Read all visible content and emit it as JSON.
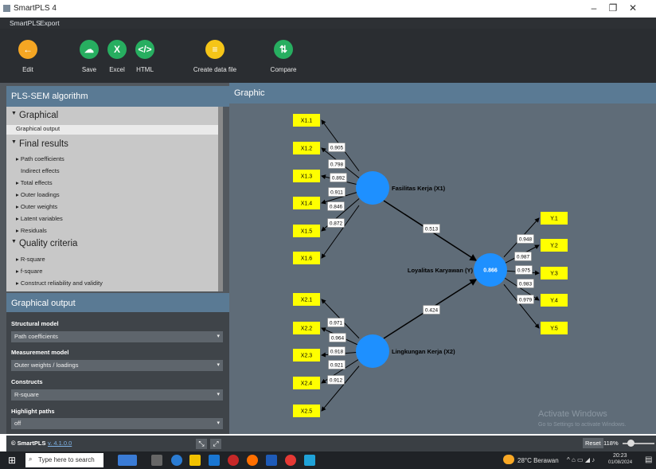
{
  "window": {
    "title": "SmartPLS 4"
  },
  "menu": [
    "SmartPLS",
    "Export"
  ],
  "toolbar": {
    "edit": "Edit",
    "save": "Save",
    "excel": "Excel",
    "html": "HTML",
    "create_data_file": "Create data file",
    "compare": "Compare",
    "colors": {
      "edit": "#f5a623",
      "save": "#27ae60",
      "excel": "#27ae60",
      "html": "#27ae60",
      "create": "#f5c518",
      "compare": "#27ae60"
    }
  },
  "left_panel": {
    "title": "PLS-SEM algorithm",
    "graphical": "Graphical",
    "graphical_output": "Graphical output",
    "final_results": "Final results",
    "final_items": [
      "Path coefficients",
      "Indirect effects",
      "Total effects",
      "Outer loadings",
      "Outer weights",
      "Latent variables",
      "Residuals"
    ],
    "quality_criteria": "Quality criteria",
    "quality_items": [
      "R-square",
      "f-square",
      "Construct reliability and validity"
    ]
  },
  "graphical_output_panel": {
    "title": "Graphical output",
    "structural_model": "Structural model",
    "structural_value": "Path coefficients",
    "measurement_model": "Measurement model",
    "measurement_value": "Outer weights / loadings",
    "constructs": "Constructs",
    "constructs_value": "R-square",
    "highlight_paths": "Highlight paths",
    "highlight_value": "off"
  },
  "footer": {
    "brand": "© SmartPLS",
    "version": "v. 4.1.0.0"
  },
  "main": {
    "title": "Graphic"
  },
  "model": {
    "x1_indicators": [
      "X1.1",
      "X1.2",
      "X1.3",
      "X1.4",
      "X1.5",
      "X1.6"
    ],
    "x1_loadings": [
      "0.905",
      "0.798",
      "0.892",
      "0.911",
      "0.846",
      "0.872"
    ],
    "x2_indicators": [
      "X2.1",
      "X2.2",
      "X2.3",
      "X2.4",
      "X2.5"
    ],
    "x2_loadings": [
      "0.971",
      "0.964",
      "0.918",
      "0.921",
      "0.912"
    ],
    "y_indicators": [
      "Y.1",
      "Y.2",
      "Y.3",
      "Y.4",
      "Y.5"
    ],
    "y_loadings": [
      "0.948",
      "0.987",
      "0.975",
      "0.983",
      "0.979"
    ],
    "x1_label": "Fasilitas Kerja (X1)",
    "x2_label": "Lingkungan Kerja (X2)",
    "y_label": "Loyalitas Karyawan (Y)",
    "y_r2": "0.866",
    "path_x1_y": "0.513",
    "path_x2_y": "0.424",
    "colors": {
      "indicator": "#ffff00",
      "construct": "#1e90ff"
    }
  },
  "watermark": {
    "line1": "Activate Windows",
    "line2": "Go to Settings to activate Windows."
  },
  "status": {
    "reset": "Reset",
    "zoom": "118%"
  },
  "taskbar": {
    "search_placeholder": "Type here to search",
    "weather": "28°C Berawan",
    "time": "20:23",
    "date": "01/08/2024"
  }
}
